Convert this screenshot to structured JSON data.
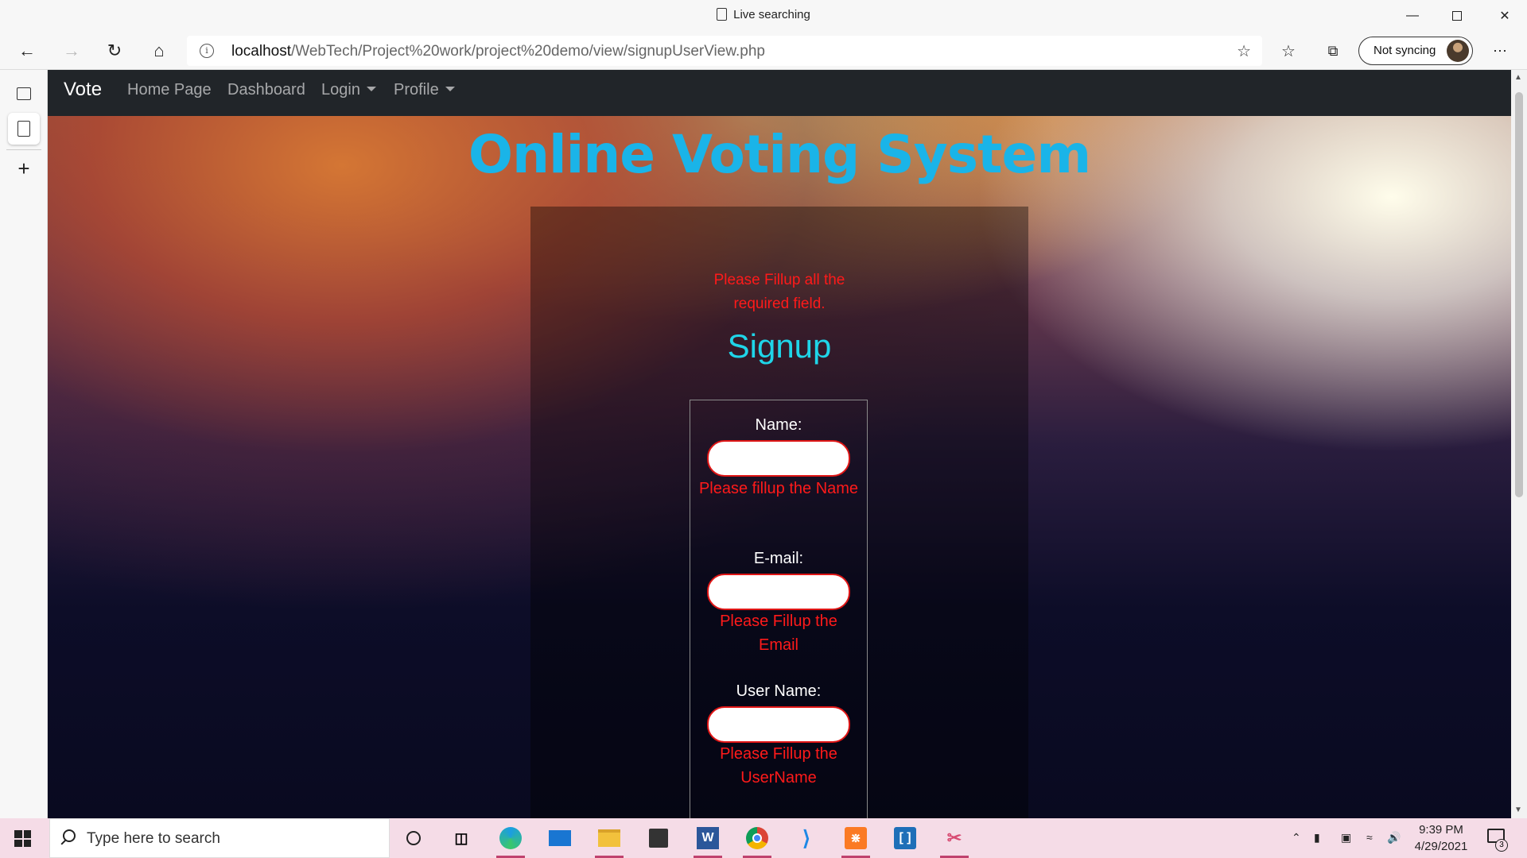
{
  "window": {
    "title": "Live searching"
  },
  "browser": {
    "url_host": "localhost",
    "url_path": "/WebTech/Project%20work/project%20demo/view/signupUserView.php",
    "sync_label": "Not syncing"
  },
  "site": {
    "brand": "Vote",
    "nav": [
      {
        "label": "Home Page"
      },
      {
        "label": "Dashboard"
      },
      {
        "label": "Login"
      },
      {
        "label": "Profile"
      }
    ],
    "heading": "Online Voting System",
    "form_error": "Please Fillup all the required field.",
    "form_title": "Signup",
    "fields": [
      {
        "label": "Name:",
        "value": "",
        "error": "Please fillup the Name"
      },
      {
        "label": "E-mail:",
        "value": "",
        "error": "Please Fillup the Email"
      },
      {
        "label": "User Name:",
        "value": "",
        "error": "Please Fillup the UserName"
      }
    ]
  },
  "taskbar": {
    "search_placeholder": "Type here to search",
    "apps": [
      "cortana-icon",
      "task-view-icon",
      "edge-icon",
      "mail-icon",
      "file-explorer-icon",
      "store-icon",
      "word-icon",
      "chrome-icon",
      "vscode-icon",
      "xampp-icon",
      "brackets-icon",
      "snipping-tool-icon"
    ],
    "time": "9:39 PM",
    "date": "4/29/2021",
    "notification_count": "3"
  },
  "colors": {
    "heading": "#1ab4e8",
    "signup": "#1fd5e8",
    "error": "#ff1a1a",
    "navbar": "#212529"
  }
}
